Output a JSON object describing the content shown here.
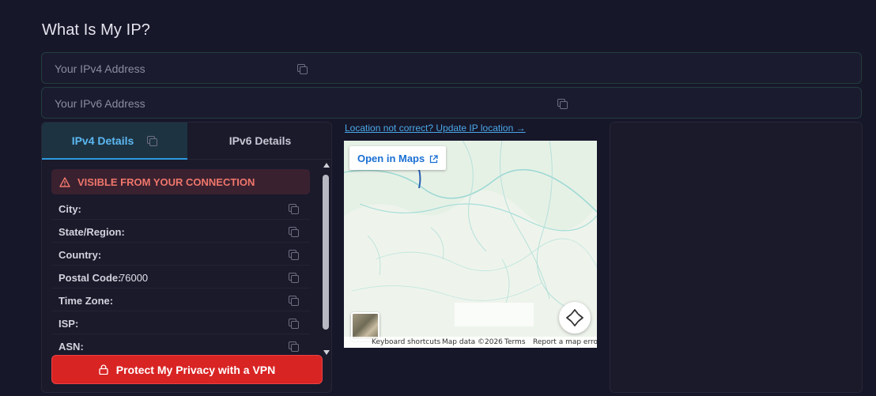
{
  "page": {
    "title": "What Is My IP?"
  },
  "ipv4_field": {
    "label": "Your IPv4 Address"
  },
  "ipv6_field": {
    "label": "Your IPv6 Address"
  },
  "tabs": [
    {
      "label": "IPv4 Details",
      "active": true
    },
    {
      "label": "IPv6 Details",
      "active": false
    }
  ],
  "warning": {
    "text": "VISIBLE FROM YOUR CONNECTION",
    "color": "#f0766b"
  },
  "details": [
    {
      "key": "City:",
      "value": ""
    },
    {
      "key": "State/Region:",
      "value": ""
    },
    {
      "key": "Country:",
      "value": ""
    },
    {
      "key": "Postal Code:",
      "value": "76000"
    },
    {
      "key": "Time Zone:",
      "value": ""
    },
    {
      "key": "ISP:",
      "value": ""
    },
    {
      "key": "ASN:",
      "value": ""
    }
  ],
  "vpn_button": {
    "label": "Protect My Privacy with a VPN",
    "color": "#d92424"
  },
  "location_link": {
    "text": "Location not correct? Update IP location →"
  },
  "map": {
    "open_button": "Open in Maps",
    "footer": {
      "shortcuts": "Keyboard shortcuts",
      "data": "Map data ©2026",
      "terms": "Terms",
      "report": "Report a map error"
    }
  },
  "icons": {
    "copy": "copy-icon",
    "warning": "warning-triangle-icon",
    "lock": "lock-icon",
    "external": "external-link-icon",
    "pan": "pan-control-icon"
  }
}
